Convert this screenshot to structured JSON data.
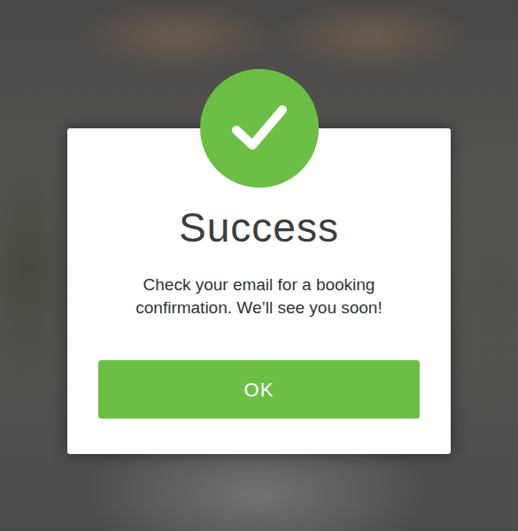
{
  "dialog": {
    "title": "Success",
    "message": "Check your email for a booking confirmation. We’ll see you soon!",
    "buttons": [
      "OK"
    ]
  }
}
